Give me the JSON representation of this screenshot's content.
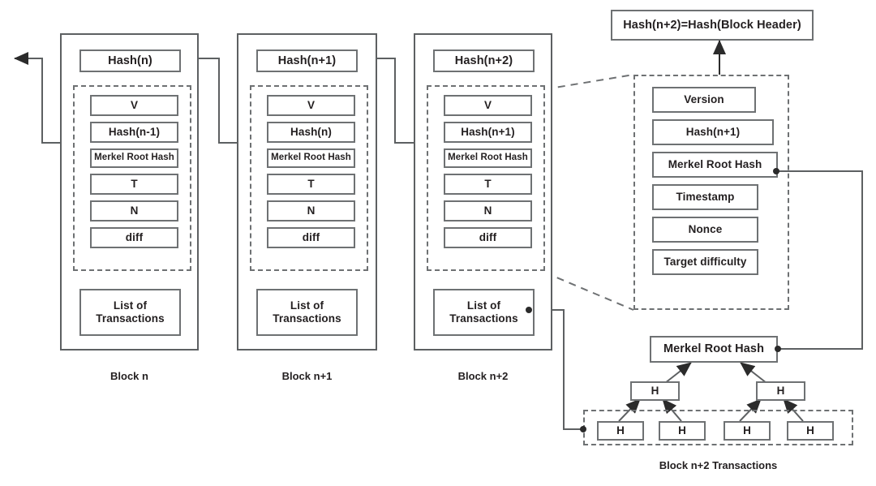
{
  "diagram": {
    "title_box": "Hash(n+2)=Hash(Block Header)",
    "blocks": [
      {
        "caption": "Block n",
        "hash_box": "Hash(n)",
        "header_fields": [
          "V",
          "Hash(n-1)",
          "Merkel Root Hash",
          "T",
          "N",
          "diff"
        ],
        "transactions_line1": "List of",
        "transactions_line2": "Transactions"
      },
      {
        "caption": "Block n+1",
        "hash_box": "Hash(n+1)",
        "header_fields": [
          "V",
          "Hash(n)",
          "Merkel Root Hash",
          "T",
          "N",
          "diff"
        ],
        "transactions_line1": "List of",
        "transactions_line2": "Transactions"
      },
      {
        "caption": "Block n+2",
        "hash_box": "Hash(n+2)",
        "header_fields": [
          "V",
          "Hash(n+1)",
          "Merkel Root Hash",
          "T",
          "N",
          "diff"
        ],
        "transactions_line1": "List of",
        "transactions_line2": "Transactions"
      }
    ],
    "expanded_header": {
      "fields": [
        "Version",
        "Hash(n+1)",
        "Merkel Root Hash",
        "Timestamp",
        "Nonce",
        "Target difficulty"
      ]
    },
    "merkle_tree": {
      "root": "Merkel Root Hash",
      "mid_nodes": [
        "H",
        "H"
      ],
      "leaf_nodes": [
        "H",
        "H",
        "H",
        "H"
      ],
      "caption": "Block n+2 Transactions"
    },
    "colors": {
      "stroke": "#5d6062",
      "box_stroke": "#6e7173",
      "text": "#231f20",
      "background": "#ffffff"
    }
  }
}
